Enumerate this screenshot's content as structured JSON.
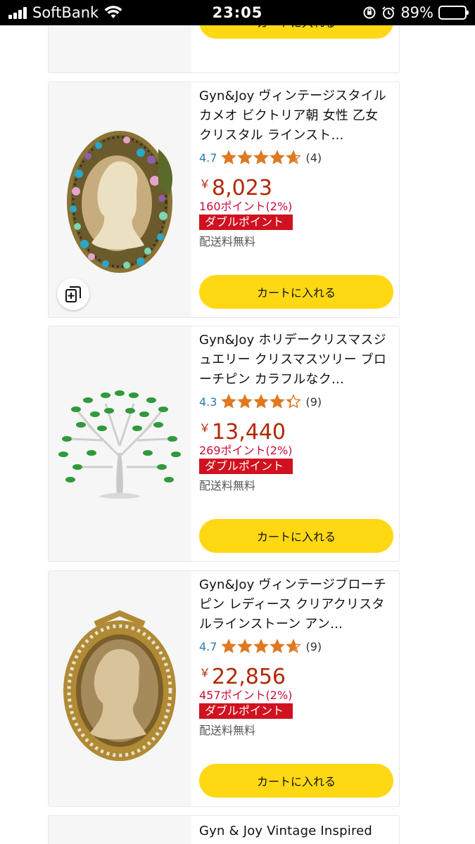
{
  "status_bar": {
    "carrier": "SoftBank",
    "time": "23:05",
    "battery_percent": "89%",
    "battery_level": 0.89
  },
  "top_card": {
    "cart_label": "カートに入れる"
  },
  "products": [
    {
      "title": "Gyn&Joy ヴィンテージスタイル カメオ ビクトリア朝 女性 乙女 クリスタル ラインスト…",
      "rating": "4.7",
      "rating_value": 4.7,
      "review_count": "(4)",
      "currency": "￥",
      "price": "8,023",
      "points": "160ポイント(2%)",
      "badge": "ダブルポイント",
      "shipping": "配送料無料",
      "cart_label": "カートに入れる",
      "image_icon": "cameo-brooch-icon",
      "has_compare": true
    },
    {
      "title": "Gyn&Joy ホリデークリスマスジュエリー クリスマスツリー ブローチピン カラフルなク…",
      "rating": "4.3",
      "rating_value": 4.3,
      "review_count": "(9)",
      "currency": "￥",
      "price": "13,440",
      "points": "269ポイント(2%)",
      "badge": "ダブルポイント",
      "shipping": "配送料無料",
      "cart_label": "カートに入れる",
      "image_icon": "tree-brooch-icon",
      "has_compare": false
    },
    {
      "title": "Gyn&Joy ヴィンテージブローチピン レディース クリアクリスタルラインストーン アン…",
      "rating": "4.7",
      "rating_value": 4.7,
      "review_count": "(9)",
      "currency": "￥",
      "price": "22,856",
      "points": "457ポイント(2%)",
      "badge": "ダブルポイント",
      "shipping": "配送料無料",
      "cart_label": "カートに入れる",
      "image_icon": "cameo-oval-brooch-icon",
      "has_compare": false
    }
  ],
  "bottom_card": {
    "title": "Gyn & Joy Vintage Inspired"
  },
  "colors": {
    "cart_button": "#ffd814",
    "price": "#b12704",
    "badge": "#d0111f",
    "star": "#de7921",
    "rating_link": "#2a7db3"
  }
}
